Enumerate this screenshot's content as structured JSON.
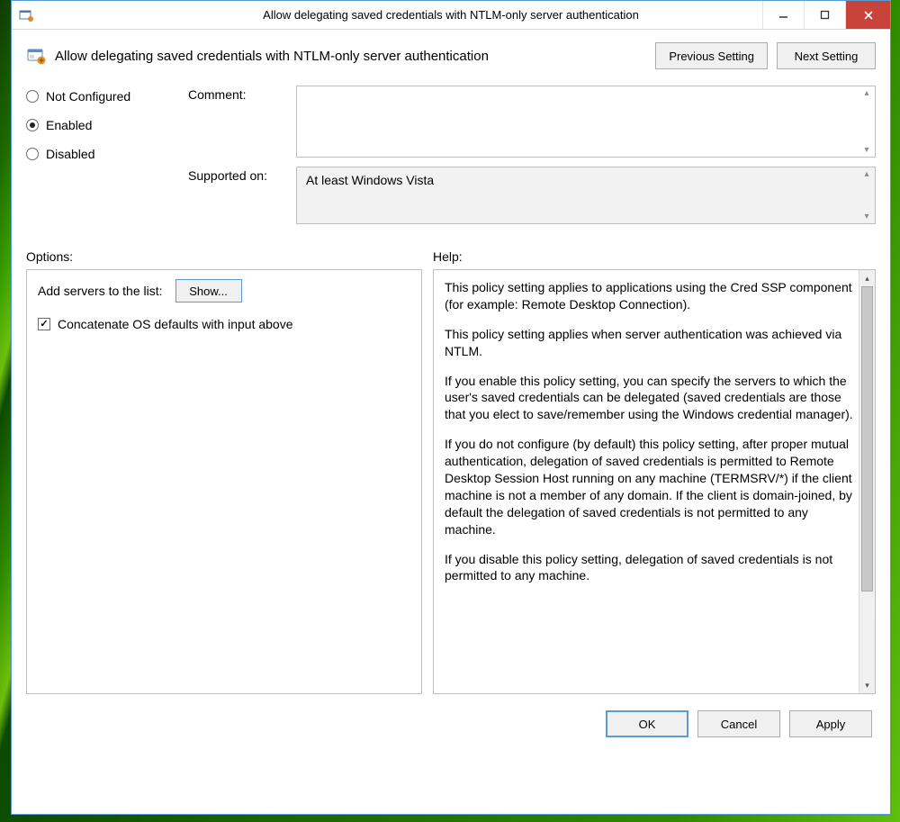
{
  "window": {
    "title": "Allow delegating saved credentials with NTLM-only server authentication"
  },
  "header": {
    "policy_name": "Allow delegating saved credentials with NTLM-only server authentication",
    "prev_label": "Previous Setting",
    "next_label": "Next Setting"
  },
  "state": {
    "not_configured": "Not Configured",
    "enabled": "Enabled",
    "disabled": "Disabled",
    "selected": "enabled"
  },
  "labels": {
    "comment": "Comment:",
    "supported_on": "Supported on:",
    "options": "Options:",
    "help": "Help:"
  },
  "supported_on_value": "At least Windows Vista",
  "options_pane": {
    "add_servers_label": "Add servers to the list:",
    "show_button": "Show...",
    "concat_label": "Concatenate OS defaults with input above",
    "concat_checked": true
  },
  "help_text": {
    "p1": "This policy setting applies to applications using the Cred SSP component (for example: Remote Desktop Connection).",
    "p2": "This policy setting applies when server authentication was achieved via NTLM.",
    "p3": "If you enable this policy setting, you can specify the servers to which the user's saved credentials can be delegated (saved credentials are those that you elect to save/remember using the Windows credential manager).",
    "p4": "If you do not configure (by default) this policy setting, after proper mutual authentication, delegation of saved credentials is permitted to Remote Desktop Session Host running on any machine (TERMSRV/*) if the client machine is not a member of any domain. If the client is domain-joined, by default the delegation of saved credentials is not permitted to any machine.",
    "p5": "If you disable this policy setting, delegation of saved credentials is not permitted to any machine."
  },
  "footer": {
    "ok": "OK",
    "cancel": "Cancel",
    "apply": "Apply"
  }
}
